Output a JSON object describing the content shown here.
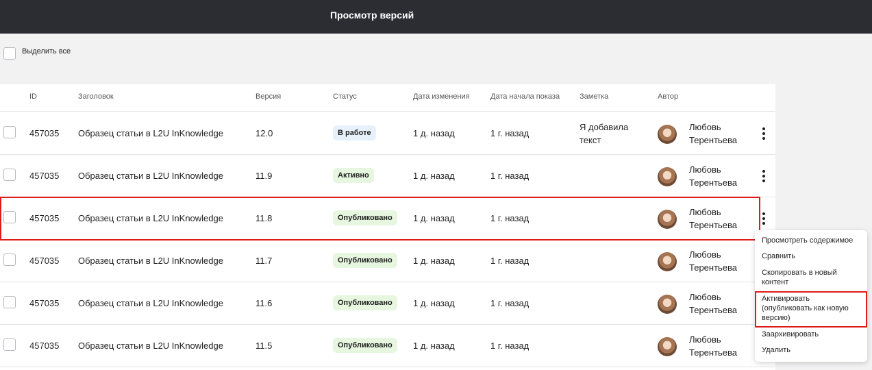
{
  "header": {
    "title": "Просмотр версий"
  },
  "select_all_label": "Выделить все",
  "columns": {
    "id": "ID",
    "title": "Заголовок",
    "version": "Версия",
    "status": "Статус",
    "changed": "Дата изменения",
    "start": "Дата начала показа",
    "note": "Заметка",
    "author": "Автор"
  },
  "rows": [
    {
      "id": "457035",
      "title": "Образец статьи в L2U InKnowledge",
      "version": "12.0",
      "status": "В работе",
      "status_color": "#e6f1fb",
      "changed": "1 д. назад",
      "start": "1 г. назад",
      "note": "Я добавила текст",
      "author": "Любовь Терентьева"
    },
    {
      "id": "457035",
      "title": "Образец статьи в L2U InKnowledge",
      "version": "11.9",
      "status": "Активно",
      "status_color": "#e6f6df",
      "changed": "1 д. назад",
      "start": "1 г. назад",
      "note": "",
      "author": "Любовь Терентьева"
    },
    {
      "id": "457035",
      "title": "Образец статьи в L2U InKnowledge",
      "version": "11.8",
      "status": "Опубликовано",
      "status_color": "#e6f6df",
      "changed": "1 д. назад",
      "start": "1 г. назад",
      "note": "",
      "author": "Любовь Терентьева"
    },
    {
      "id": "457035",
      "title": "Образец статьи в L2U InKnowledge",
      "version": "11.7",
      "status": "Опубликовано",
      "status_color": "#e6f6df",
      "changed": "1 д. назад",
      "start": "1 г. назад",
      "note": "",
      "author": "Любовь Терентьева"
    },
    {
      "id": "457035",
      "title": "Образец статьи в L2U InKnowledge",
      "version": "11.6",
      "status": "Опубликовано",
      "status_color": "#e6f6df",
      "changed": "1 д. назад",
      "start": "1 г. назад",
      "note": "",
      "author": "Любовь Терентьева"
    },
    {
      "id": "457035",
      "title": "Образец статьи в L2U InKnowledge",
      "version": "11.5",
      "status": "Опубликовано",
      "status_color": "#e6f6df",
      "changed": "1 д. назад",
      "start": "1 г. назад",
      "note": "",
      "author": "Любовь Терентьева"
    }
  ],
  "context_menu": {
    "items": [
      "Просмотреть содержимое",
      "Сравнить",
      "Скопировать в новый\nконтент",
      "Активировать\n(опубликовать как новую\nверсию)",
      "Заархивировать",
      "Удалить"
    ]
  },
  "colors": {
    "header_bg": "#2c2c33",
    "highlight": "#e01b1b",
    "badge_green": "#e6f6df",
    "badge_blue": "#e6f1fb"
  }
}
